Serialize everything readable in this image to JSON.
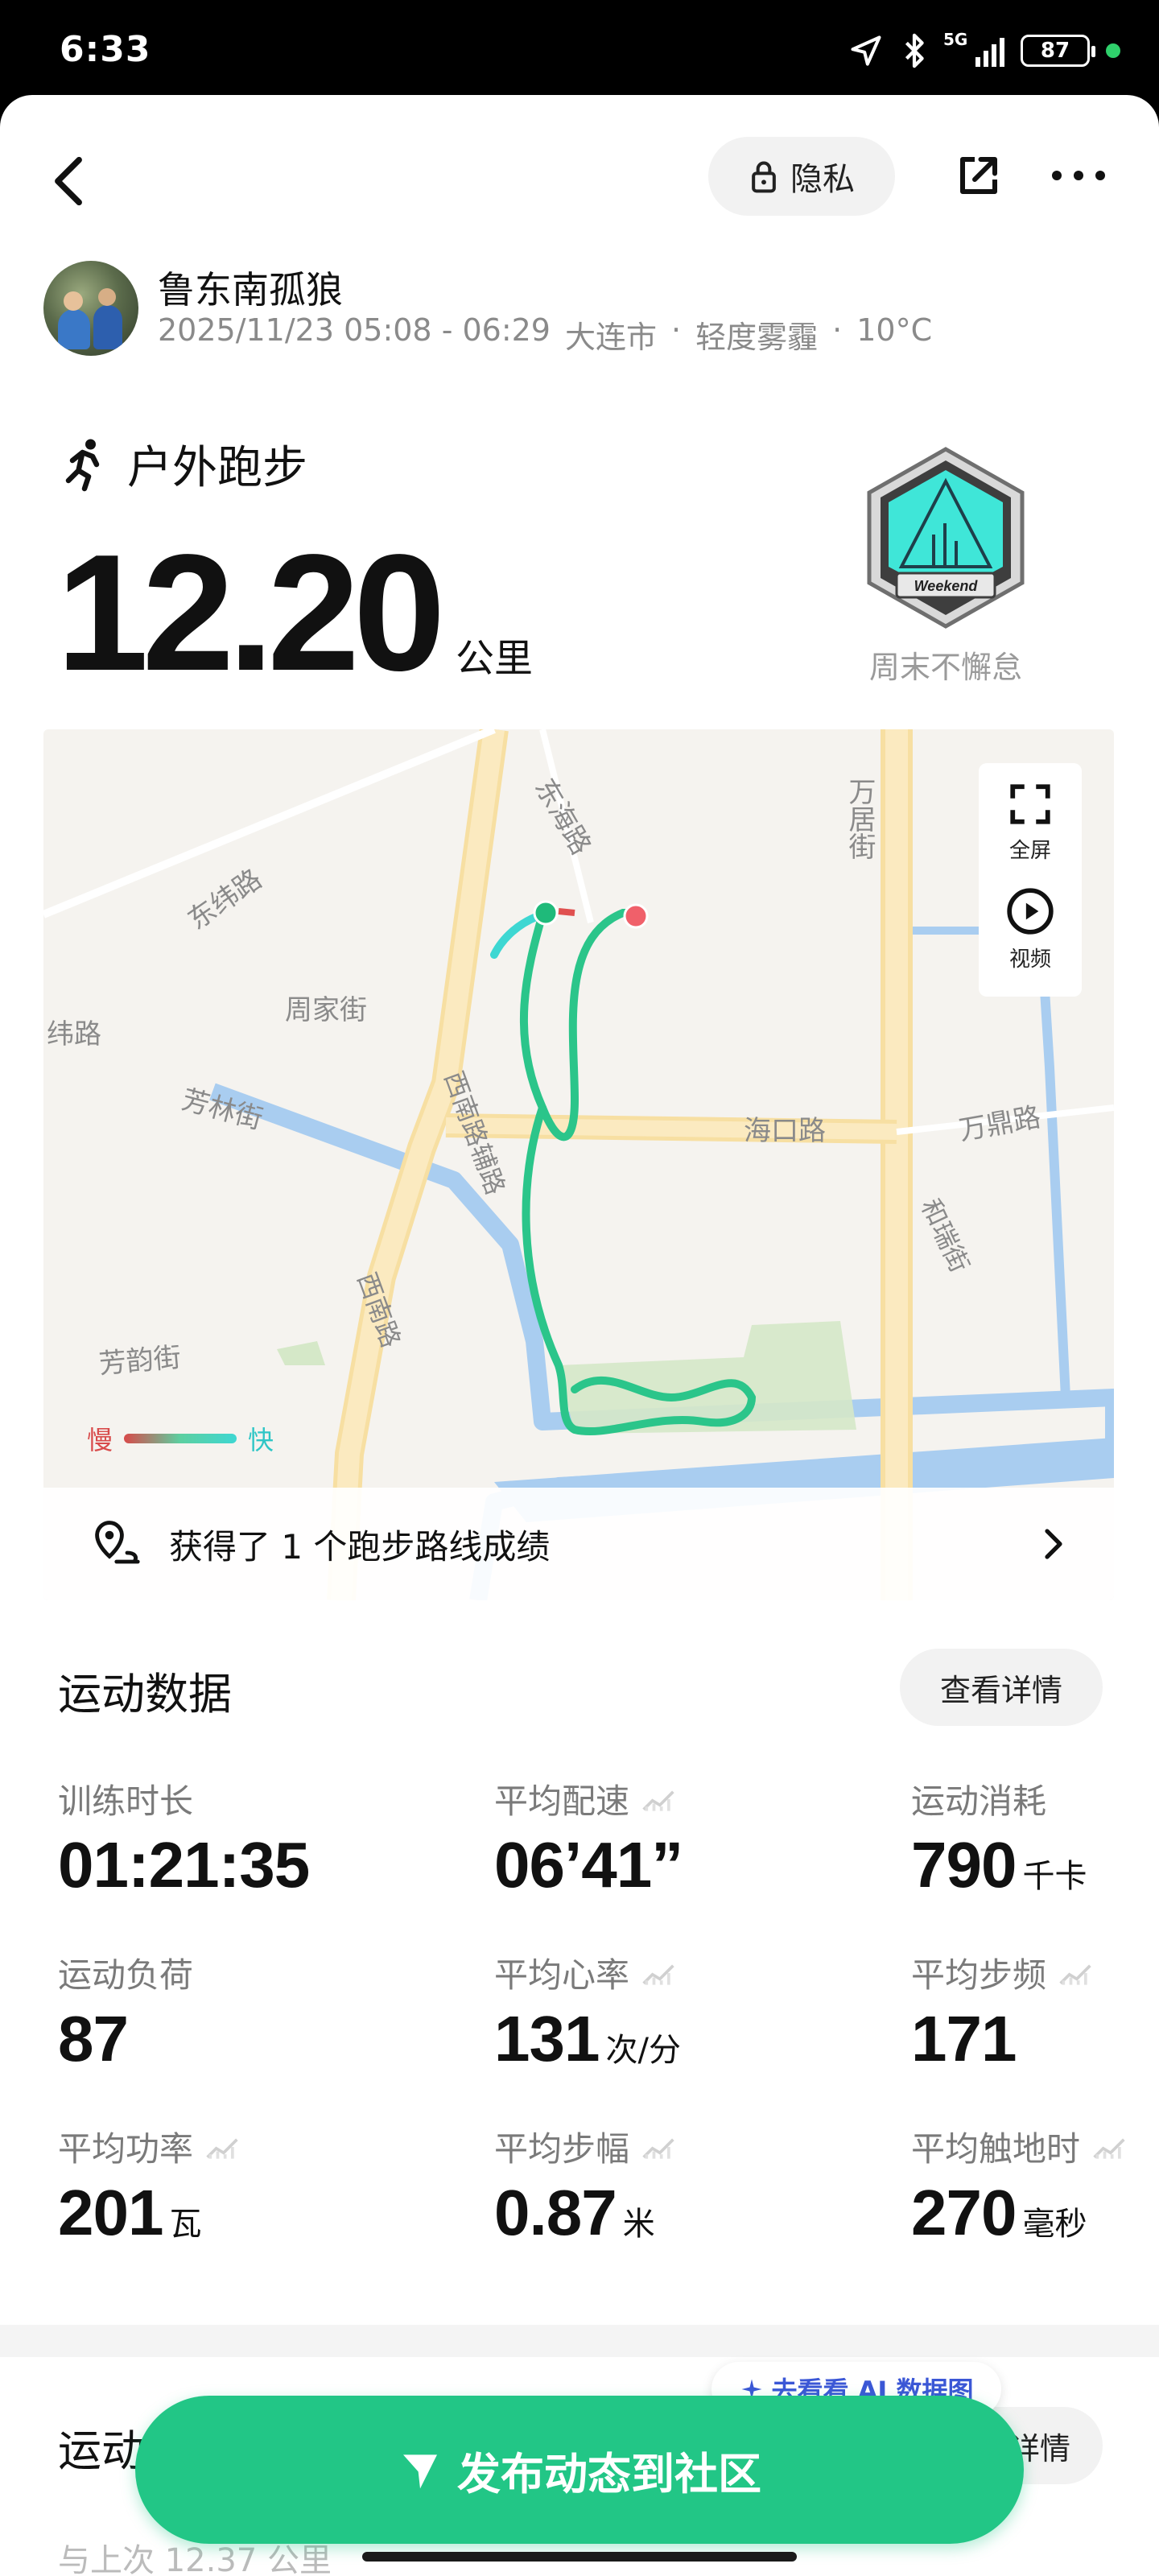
{
  "status_bar": {
    "time": "6:33",
    "network": "5G",
    "battery": "87"
  },
  "header": {
    "privacy_label": "隐私"
  },
  "user": {
    "name": "鲁东南孤狼",
    "date": "2025/11/23 05:08 - 06:29",
    "city": "大连市",
    "weather": "轻度雾霾",
    "temperature": "10°C",
    "sep": "·"
  },
  "activity": {
    "type": "户外跑步",
    "distance": "12.20",
    "unit": "公里"
  },
  "badge": {
    "text": "Weekend",
    "label": "周末不懈怠"
  },
  "map": {
    "controls": {
      "fullscreen": "全屏",
      "video": "视频"
    },
    "legend": {
      "slow": "慢",
      "fast": "快"
    },
    "streets": [
      "东海路",
      "东纬路",
      "周家街",
      "纬路",
      "芳林街",
      "西南路辅路",
      "西南路",
      "海口路",
      "万居街",
      "万鼎路",
      "和瑞街",
      "芳韵街"
    ],
    "route_achievement": "获得了 1 个跑步路线成绩"
  },
  "stats": {
    "title": "运动数据",
    "details_label": "查看详情",
    "items": [
      {
        "label": "训练时长",
        "value": "01:21:35",
        "unit": ""
      },
      {
        "label": "平均配速",
        "value": "06’41”",
        "unit": ""
      },
      {
        "label": "运动消耗",
        "value": "790",
        "unit": "千卡"
      },
      {
        "label": "运动负荷",
        "value": "87",
        "unit": ""
      },
      {
        "label": "平均心率",
        "value": "131",
        "unit": "次/分"
      },
      {
        "label": "平均步频",
        "value": "171",
        "unit": ""
      },
      {
        "label": "平均功率",
        "value": "201",
        "unit": "瓦"
      },
      {
        "label": "平均步幅",
        "value": "0.87",
        "unit": "米"
      },
      {
        "label": "平均触地时",
        "value": "270",
        "unit": "毫秒"
      }
    ]
  },
  "section2": {
    "title": "运动",
    "details_label": "详情",
    "subtitle": "与上次 12.37 公里"
  },
  "ai": {
    "label": "去看看 AI 数据图"
  },
  "publish": {
    "label": "发布动态到社区"
  },
  "colors": {
    "accent": "#22c686",
    "route": "#2bc58a",
    "ai": "#3b57d6"
  }
}
